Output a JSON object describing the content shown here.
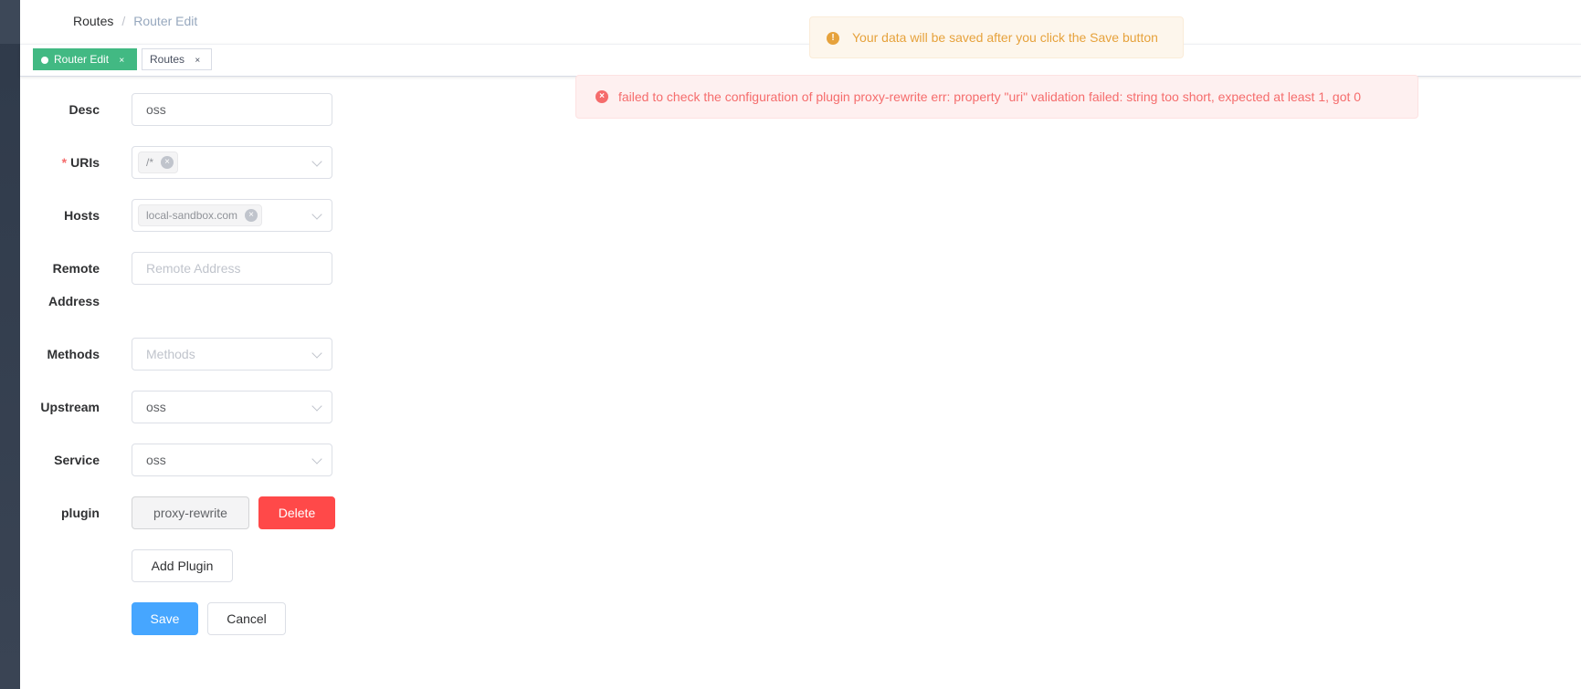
{
  "breadcrumb": {
    "parent": "Routes",
    "separator": "/",
    "current": "Router Edit"
  },
  "tags": [
    {
      "label": "Router Edit",
      "close": "×",
      "active": true
    },
    {
      "label": "Routes",
      "close": "×",
      "active": false
    }
  ],
  "notifications": {
    "warning": {
      "icon": "warning-icon",
      "glyph": "!",
      "text": "Your data will be saved after you click the Save button"
    },
    "error": {
      "icon": "error-icon",
      "glyph": "×",
      "text": "failed to check the configuration of plugin proxy-rewrite err: property \"uri\" validation failed: string too short, expected at least 1, got 0"
    }
  },
  "form": {
    "desc": {
      "label": "Desc",
      "value": "oss"
    },
    "uris": {
      "label": "URIs",
      "required": true,
      "tags": [
        "/*"
      ]
    },
    "hosts": {
      "label": "Hosts",
      "tags": [
        "local-sandbox.com"
      ]
    },
    "remote_address": {
      "label_line1": "Remote",
      "label_line2": "Address",
      "placeholder": "Remote Address",
      "value": ""
    },
    "methods": {
      "label": "Methods",
      "placeholder": "Methods"
    },
    "upstream": {
      "label": "Upstream",
      "value": "oss"
    },
    "service": {
      "label": "Service",
      "value": "oss"
    },
    "plugin": {
      "label": "plugin",
      "name": "proxy-rewrite",
      "delete_label": "Delete"
    },
    "add_plugin_label": "Add Plugin",
    "save_label": "Save",
    "cancel_label": "Cancel"
  },
  "colors": {
    "sidebar": "#304156",
    "tag_active": "#42b983",
    "primary": "#46a6ff",
    "danger": "#ff4949",
    "warning": "#e6a23c",
    "error": "#f56c6c"
  }
}
